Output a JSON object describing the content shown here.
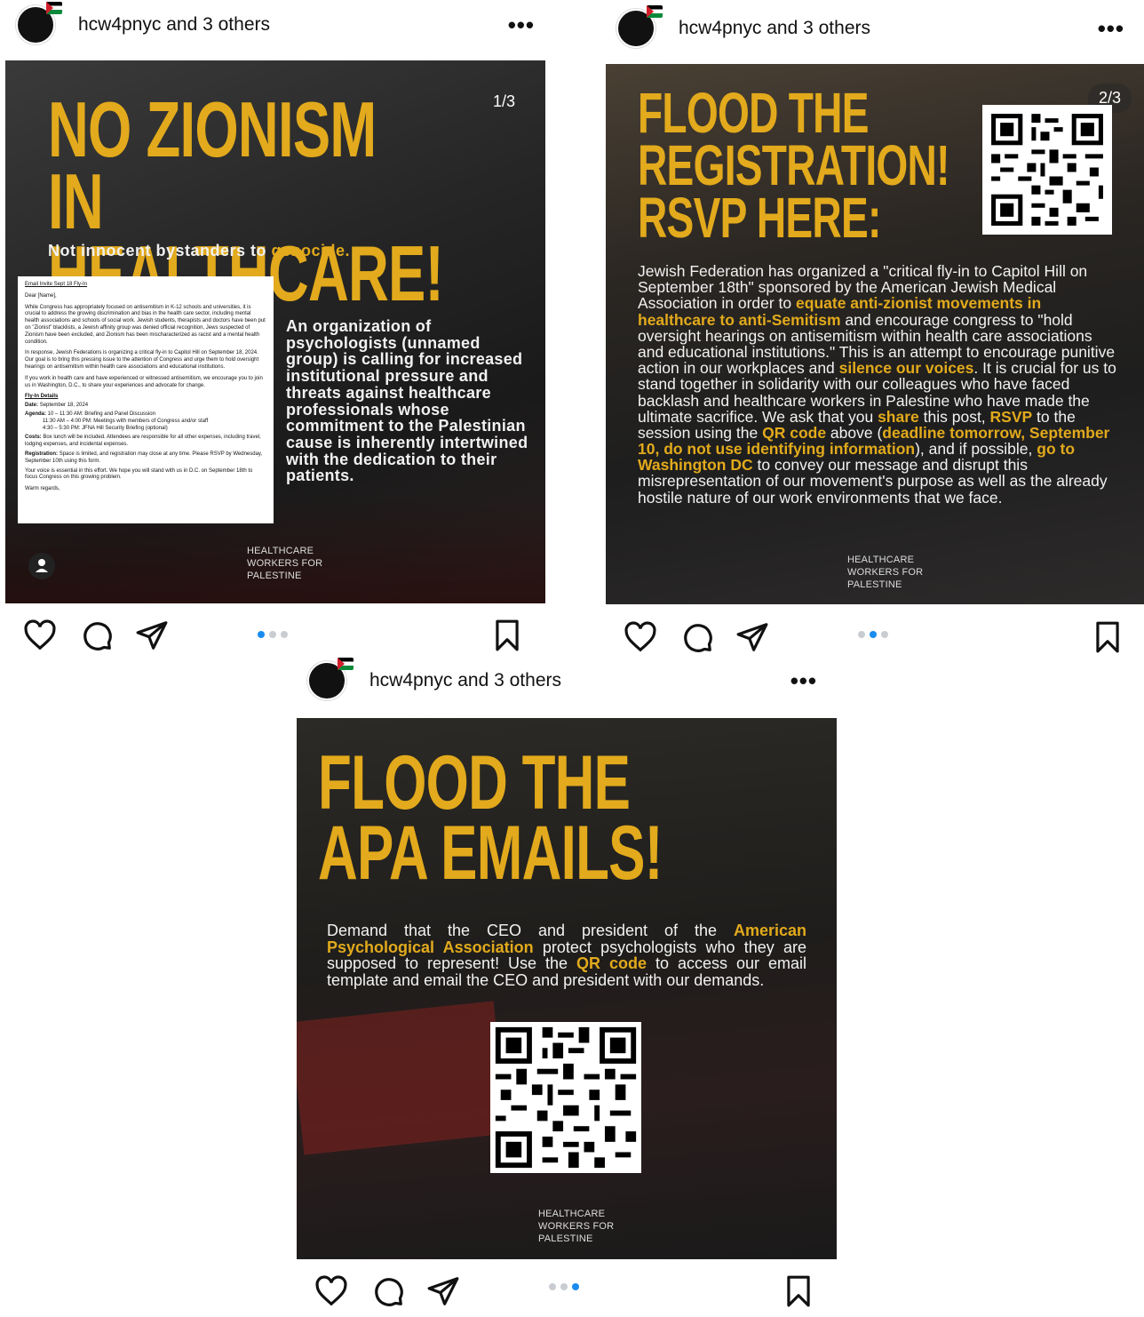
{
  "posts": [
    {
      "username": "hcw4pnyc",
      "others": "and 3 others",
      "more": "•••",
      "counter": "1/3",
      "headline_line1": "NO ZIONISM",
      "headline_line2": "IN HEALTHCARE!",
      "subhead_prefix": "Not innocent bystanders to ",
      "subhead_highlight": "genocide.",
      "side_text": "An organization of psychologists (unnamed group) is calling for increased institutional pressure and threats against healthcare professionals whose commitment to the Palestinian cause is inherently intertwined with the dedication to their patients.",
      "doc": {
        "title": "Email Invite Sept 18 Fly-In",
        "greeting": "Dear [Name],",
        "p1": "While Congress has appropriately focused on antisemitism in K-12 schools and universities, it is crucial to address the growing discrimination and bias in the health care sector, including mental health associations and schools of social work. Jewish students, therapists and doctors have been put on \"Zionist\" blacklists, a Jewish affinity group was denied official recognition, Jews suspected of Zionism have been excluded, and Zionism has been mischaracterized as racist and a mental health condition.",
        "p2": "In response, Jewish Federations is organizing a critical fly-in to Capitol Hill on September 18, 2024. Our goal is to bring this pressing issue to the attention of Congress and urge them to hold oversight hearings on antisemitism within health care associations and educational institutions.",
        "p3": "If you work in health care and have experienced or witnessed antisemitism, we encourage you to join us in Washington, D.C., to share your experiences and advocate for change.",
        "details_title": "Fly-In Details",
        "date_label": "Date:",
        "date_value": "September 18, 2024",
        "agenda_label": "Agenda:",
        "agenda_1": "10 – 11:30 AM:   Briefing and Panel Discussion",
        "agenda_2": "11:30 AM – 4:00 PM:   Meetings with members of Congress and/or staff",
        "agenda_3": "4:30 – 5:30 PM:   JFNA Hill Security Briefing (optional)",
        "costs_label": "Costs:",
        "costs_value": "Box lunch will be included. Attendees are responsible for all other expenses, including travel, lodging expenses, and incidental expenses.",
        "registration_label": "Registration:",
        "registration_value": "Space is limited, and registration may close at any time. Please RSVP by Wednesday, September 10th using this form.",
        "closing": "Your voice is essential in this effort. We hope you will stand with us in D.C. on September 18th to focus Congress on this growing problem.",
        "regards": "Warm regards,"
      },
      "footer_logo": [
        "HEALTHCARE",
        "WORKERS FOR",
        "PALESTINE"
      ]
    },
    {
      "username": "hcw4pnyc",
      "others": "and 3 others",
      "more": "•••",
      "counter": "2/3",
      "headline_line1": "FLOOD THE",
      "headline_line2": "REGISTRATION!",
      "headline_line3": "RSVP HERE:",
      "body": [
        {
          "t": "Jewish Federation has organized a \"critical fly-in to Capitol Hill on September 18th\" sponsored by the American Jewish Medical Association in order to ",
          "h": false
        },
        {
          "t": "equate anti-zionist movements in healthcare to anti-Semitism",
          "h": true
        },
        {
          "t": " and encourage congress to \"hold oversight hearings on antisemitism within health care associations and educational institutions.\" This is an attempt to encourage punitive action in our workplaces and ",
          "h": false
        },
        {
          "t": "silence our voices",
          "h": true
        },
        {
          "t": ". It is crucial for us to stand together in solidarity with our colleagues who have faced backlash and healthcare workers in Palestine who have made the ultimate sacrifice. We ask that you ",
          "h": false
        },
        {
          "t": "share",
          "h": true
        },
        {
          "t": " this post, ",
          "h": false
        },
        {
          "t": "RSVP",
          "h": true
        },
        {
          "t": " to the session using the ",
          "h": false
        },
        {
          "t": "QR code",
          "h": true
        },
        {
          "t": " above (",
          "h": false
        },
        {
          "t": "deadline tomorrow, September 10, do not use identifying information",
          "h": true
        },
        {
          "t": "), and if possible, ",
          "h": false
        },
        {
          "t": "go to Washington DC",
          "h": true
        },
        {
          "t": " to convey our message and disrupt this misrepresentation of our movement's purpose as well as the already hostile nature of our work environments that we face.",
          "h": false
        }
      ],
      "footer_logo": [
        "HEALTHCARE",
        "WORKERS FOR",
        "PALESTINE"
      ]
    },
    {
      "username": "hcw4pnyc",
      "others": "and 3 others",
      "more": "•••",
      "headline_line1": "FLOOD THE",
      "headline_line2": "APA EMAILS!",
      "body": [
        {
          "t": "Demand that the CEO and president of the ",
          "h": false
        },
        {
          "t": "American Psychological Association",
          "h": true
        },
        {
          "t": " protect psychologists who they are supposed to represent! Use the ",
          "h": false
        },
        {
          "t": "QR code",
          "h": true
        },
        {
          "t": " to access our email template and email the CEO and president with our demands.",
          "h": false
        }
      ],
      "footer_logo": [
        "HEALTHCARE",
        "WORKERS FOR",
        "PALESTINE"
      ]
    }
  ],
  "colors": {
    "accent": "#e2aa1c",
    "dot_active": "#1a8cf0",
    "dot_inactive": "#c9cdd2"
  },
  "icons": [
    "heart-icon",
    "comment-icon",
    "share-icon",
    "bookmark-icon",
    "more-icon"
  ]
}
